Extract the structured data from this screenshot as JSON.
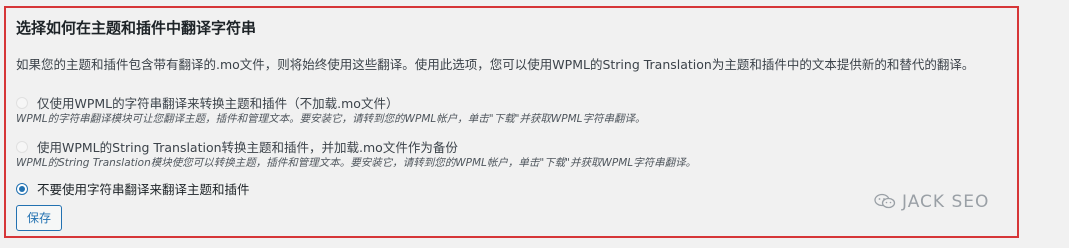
{
  "section": {
    "title": "选择如何在主题和插件中翻译字符串",
    "description": "如果您的主题和插件包含带有翻译的.mo文件，则将始终使用这些翻译。使用此选项，您可以使用WPML的String Translation为主题和插件中的文本提供新的和替代的翻译。"
  },
  "options": [
    {
      "label": "仅使用WPML的字符串翻译来转换主题和插件（不加载.mo文件）",
      "hint": "WPML的字符串翻译模块可让您翻译主题，插件和管理文本。要安装它，请转到您的WPML帐户，单击\"下载\"并获取WPML字符串翻译。",
      "selected": false,
      "enabled": false
    },
    {
      "label": "使用WPML的String Translation转换主题和插件，并加载.mo文件作为备份",
      "hint": "WPML的String Translation模块使您可以转换主题，插件和管理文本。要安装它，请转到您的WPML帐户，单击\"下载\"并获取WPML字符串翻译。",
      "selected": false,
      "enabled": false
    },
    {
      "label": "不要使用字符串翻译来翻译主题和插件",
      "selected": true,
      "enabled": true
    }
  ],
  "save_label": "保存",
  "watermark": {
    "text": "JACK SEO",
    "icon": "wechat-logo-icon"
  },
  "colors": {
    "highlight_border": "#d63638",
    "accent": "#2271b1"
  }
}
